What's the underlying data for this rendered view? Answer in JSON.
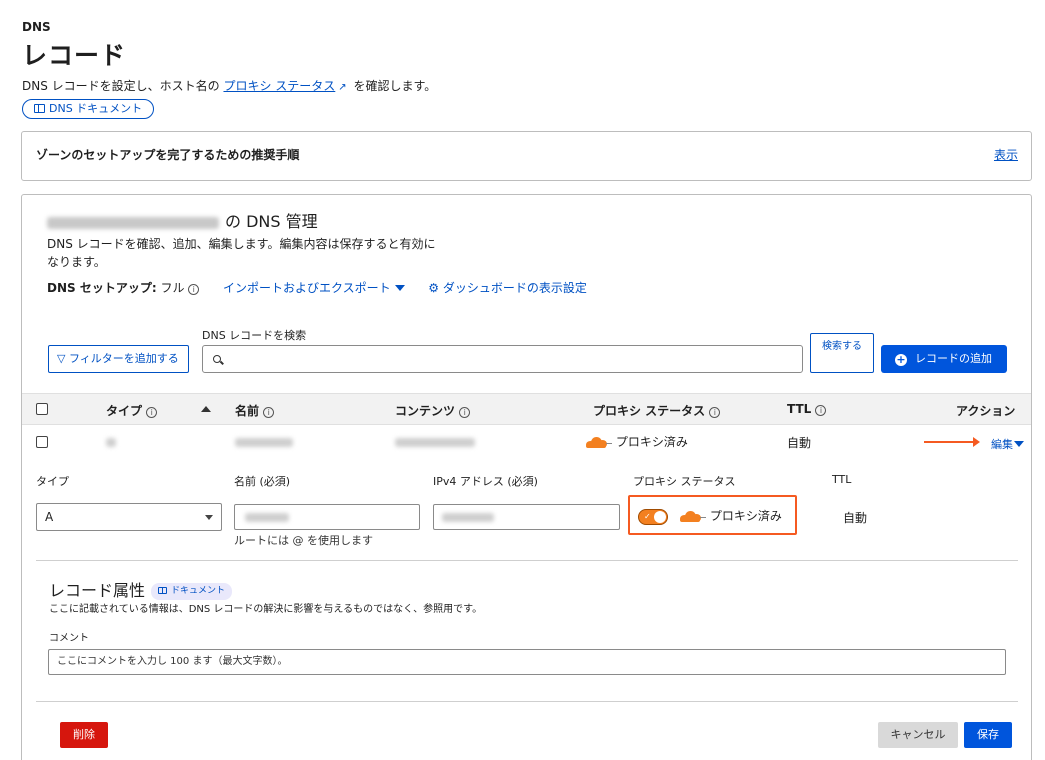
{
  "header": {
    "breadcrumb": "DNS",
    "title": "レコード",
    "desc_before": "DNS レコードを設定し、ホスト名の ",
    "desc_link": "プロキシ ステータス",
    "desc_after": " を確認します。",
    "doc_button": "DNS ドキュメント"
  },
  "zone_setup": {
    "title": "ゾーンのセットアップを完了するための推奨手順",
    "show_link": "表示"
  },
  "management": {
    "title_suffix": "の DNS 管理",
    "description": "DNS レコードを確認、追加、編集します。編集内容は保存すると有効になります。",
    "setup_label": "DNS セットアップ:",
    "setup_value": "フル",
    "import_export": "インポートおよびエクスポート",
    "dashboard_settings": "ダッシュボードの表示設定"
  },
  "search": {
    "label": "DNS レコードを検索",
    "filter_button": "フィルターを追加する",
    "search_button": "検索する",
    "add_button": "レコードの追加"
  },
  "table": {
    "headers": {
      "type": "タイプ",
      "name": "名前",
      "content": "コンテンツ",
      "proxy": "プロキシ ステータス",
      "ttl": "TTL",
      "action": "アクション"
    },
    "row": {
      "proxy": "プロキシ済み",
      "ttl": "自動",
      "edit": "編集"
    }
  },
  "edit_form": {
    "type_label": "タイプ",
    "type_value": "A",
    "name_label": "名前 (必須)",
    "ipv4_label": "IPv4 アドレス (必須)",
    "proxy_label": "プロキシ ステータス",
    "proxy_value": "プロキシ済み",
    "ttl_label": "TTL",
    "ttl_value": "自動",
    "root_hint": "ルートには @ を使用します"
  },
  "attributes": {
    "title": "レコード属性",
    "doc_pill": "ドキュメント",
    "description": "ここに記載されている情報は、DNS レコードの解決に影響を与えるものではなく、参照用です。",
    "comment_label": "コメント",
    "comment_placeholder": "ここにコメントを入力し 100 ます（最大文字数）。"
  },
  "footer": {
    "delete": "削除",
    "cancel": "キャンセル",
    "save": "保存"
  },
  "colors": {
    "link": "#0051c3",
    "primary": "#0055dc",
    "orange": "#f38020",
    "highlight": "#f55a21",
    "danger": "#d6160d"
  }
}
